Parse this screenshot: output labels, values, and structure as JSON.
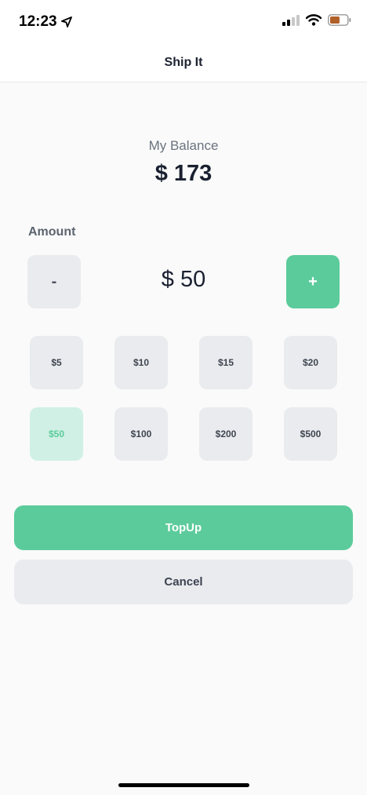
{
  "status_bar": {
    "time": "12:23",
    "icons": [
      "location-arrow-icon",
      "signal-icon",
      "wifi-icon",
      "battery-icon"
    ],
    "battery_color": "#b0602a"
  },
  "nav": {
    "title": "Ship It"
  },
  "balance": {
    "label": "My Balance",
    "value": "$ 173"
  },
  "amount": {
    "label": "Amount",
    "minus_label": "-",
    "plus_label": "+",
    "value": "$ 50"
  },
  "presets": [
    {
      "label": "$5",
      "selected": false
    },
    {
      "label": "$10",
      "selected": false
    },
    {
      "label": "$15",
      "selected": false
    },
    {
      "label": "$20",
      "selected": false
    },
    {
      "label": "$50",
      "selected": true
    },
    {
      "label": "$100",
      "selected": false
    },
    {
      "label": "$200",
      "selected": false
    },
    {
      "label": "$500",
      "selected": false
    }
  ],
  "actions": {
    "topup_label": "TopUp",
    "cancel_label": "Cancel"
  },
  "colors": {
    "accent": "#5bcb9b",
    "accent_soft": "#d0f0e5",
    "neutral_button": "#e9ebee",
    "background": "#f9faf9"
  }
}
